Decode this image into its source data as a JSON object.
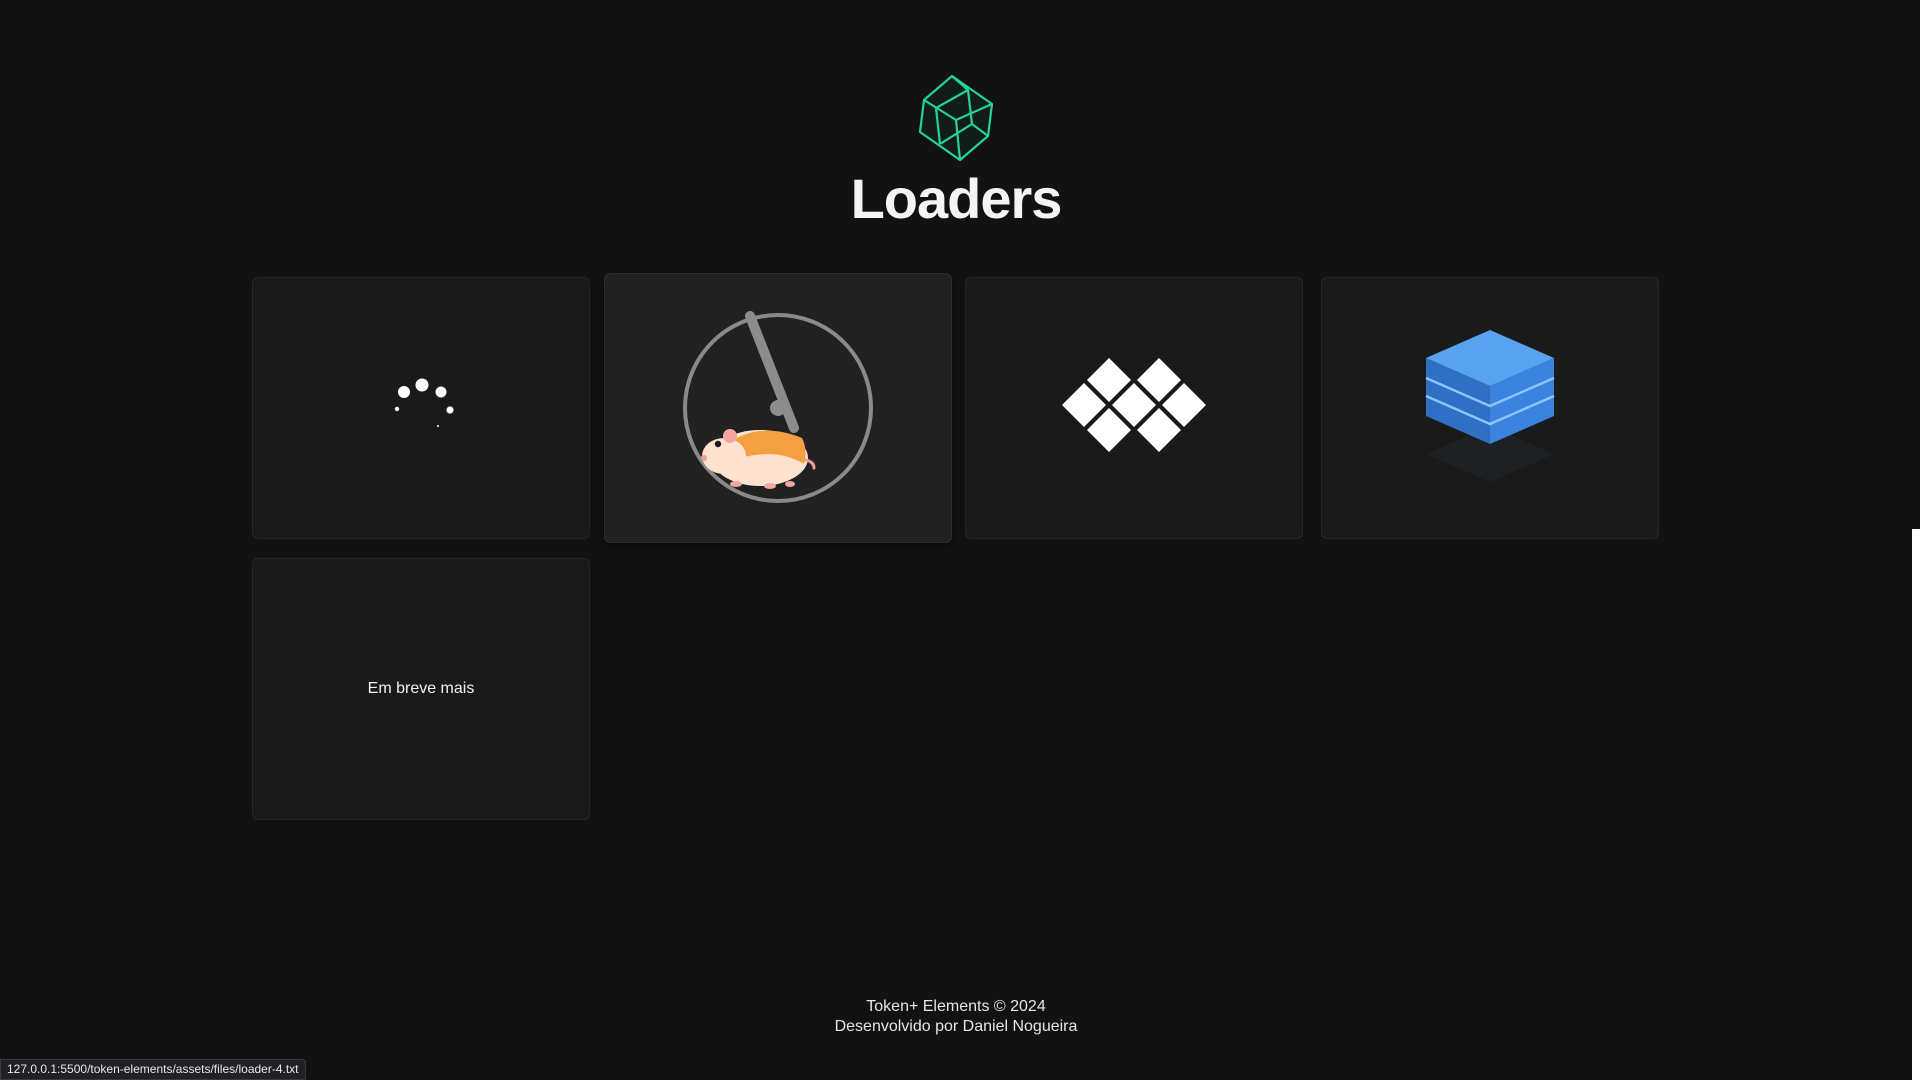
{
  "page": {
    "title": "Loaders"
  },
  "logo": {
    "icon": "green-cube-icon",
    "color": "#22d39a"
  },
  "cards": [
    {
      "name": "loader-dots-spinner",
      "icon": "dots-spinner-icon"
    },
    {
      "name": "loader-hamster-wheel",
      "icon": "hamster-wheel-icon"
    },
    {
      "name": "loader-diamond-grid",
      "icon": "diamond-grid-icon"
    },
    {
      "name": "loader-blue-layers",
      "icon": "layers-stack-icon",
      "color": "#3b8df0"
    },
    {
      "name": "coming-soon-card",
      "label": "Em breve mais"
    }
  ],
  "footer": {
    "line1": "Token+ Elements © 2024",
    "line2": "Desenvolvido por Daniel Nogueira"
  },
  "status_bar": {
    "url": "127.0.0.1:5500/token-elements/assets/files/loader-4.txt"
  }
}
